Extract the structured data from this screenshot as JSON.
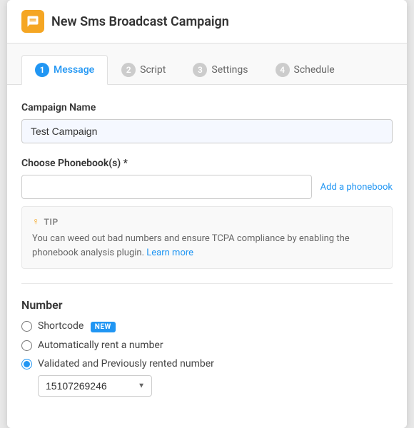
{
  "window": {
    "title": "New Sms Broadcast Campaign"
  },
  "tabs": [
    {
      "id": "message",
      "number": "1",
      "label": "Message",
      "active": true
    },
    {
      "id": "script",
      "number": "2",
      "label": "Script",
      "active": false
    },
    {
      "id": "settings",
      "number": "3",
      "label": "Settings",
      "active": false
    },
    {
      "id": "schedule",
      "number": "4",
      "label": "Schedule",
      "active": false
    }
  ],
  "form": {
    "campaign_name_label": "Campaign Name",
    "campaign_name_value": "Test Campaign",
    "phonebook_label": "Choose Phonebook(s) *",
    "add_phonebook_link": "Add a phonebook",
    "tip_label": "TIP",
    "tip_text": "You can weed out bad numbers and ensure TCPA compliance by enabling the phonebook analysis plugin.",
    "tip_link": "Learn more",
    "number_label": "Number",
    "radio_options": [
      {
        "id": "shortcode",
        "label": "Shortcode",
        "badge": "NEW",
        "checked": false
      },
      {
        "id": "auto_rent",
        "label": "Automatically rent a number",
        "badge": null,
        "checked": false
      },
      {
        "id": "validated",
        "label": "Validated and Previously rented number",
        "badge": null,
        "checked": true
      }
    ],
    "phone_number_select": {
      "value": "15107269246",
      "options": [
        "15107269246"
      ]
    }
  }
}
